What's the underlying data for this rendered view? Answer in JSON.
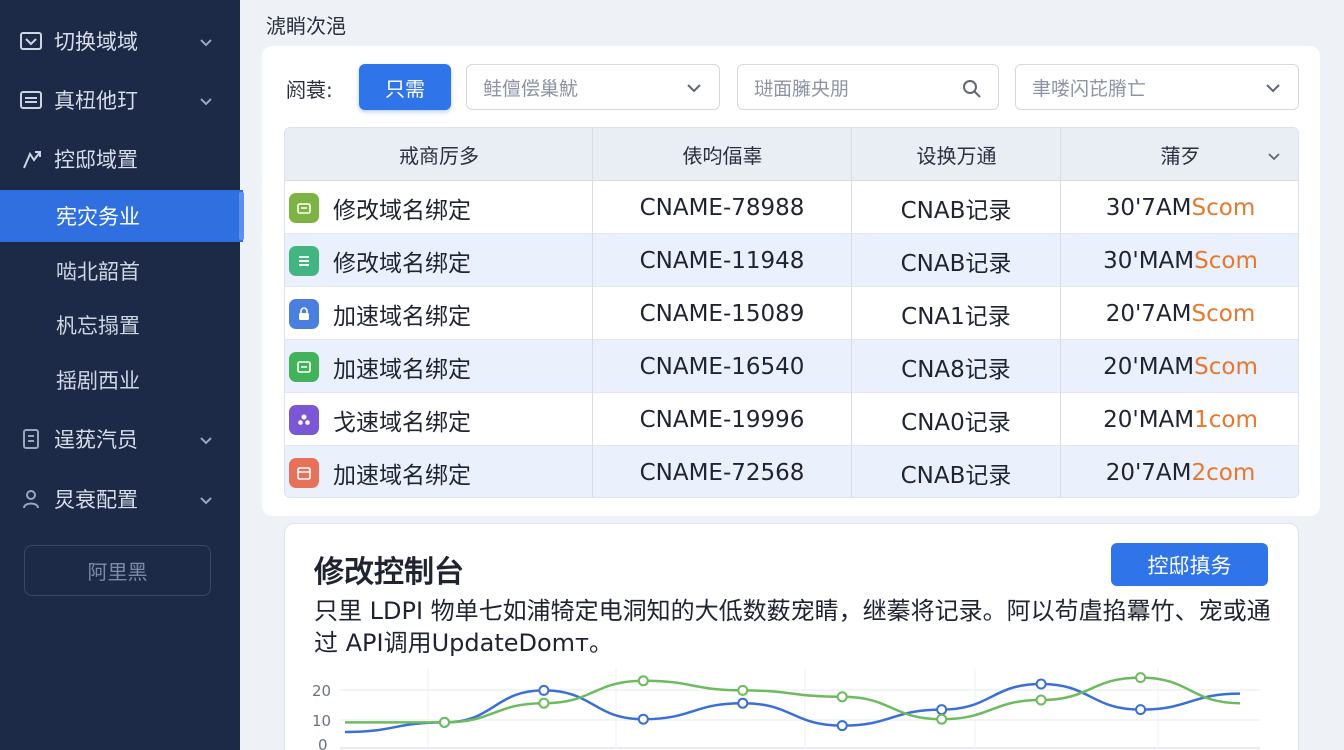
{
  "sidebar": {
    "items": [
      {
        "label": "切换域域",
        "icon": "browser-icon"
      },
      {
        "label": "真杻他玎",
        "icon": "list-icon"
      },
      {
        "label": "控邸域置",
        "icon": "pointer-icon"
      }
    ],
    "sub_items": [
      {
        "label": "宪灾务业"
      },
      {
        "label": "啮北韶首"
      },
      {
        "label": "杋忘搨置"
      },
      {
        "label": "揺剧西业"
      }
    ],
    "items_bottom": [
      {
        "label": "逞莸汽员",
        "icon": "document-icon"
      },
      {
        "label": "炅衰配置",
        "icon": "user-group-icon"
      }
    ],
    "footer_button": "阿里黑"
  },
  "main": {
    "title": "淲睄次浥",
    "filter": {
      "label": "阏蓑:",
      "primary_button": "只需",
      "select_1": "鲑儃偿巢魷",
      "search_placeholder": "琎面臃央朋",
      "select_2": "聿喽闪芘膌亡"
    },
    "table": {
      "headers": [
        "戒商厉多",
        "俵呁偪辜",
        "设换万通",
        "蒲歹"
      ],
      "rows": [
        {
          "name": "修改域名绑定",
          "cname": "CNAME-78988",
          "type": "CNAB记录",
          "time": "30'7AM",
          "suffix": "Scom",
          "icon_color": "#7cb342",
          "icon": "tag-icon"
        },
        {
          "name": "修改域名绑定",
          "cname": "CNAME-11948",
          "type": "CNAB记录",
          "time": "30'MAM",
          "suffix": "Scom",
          "icon_color": "#43b581",
          "icon": "list-icon"
        },
        {
          "name": "加速域名绑定",
          "cname": "CNAME-15089",
          "type": "CNA1记录",
          "time": "20'7AM",
          "suffix": "Scom",
          "icon_color": "#4a7fe0",
          "icon": "lock-icon"
        },
        {
          "name": "加速域名绑定",
          "cname": "CNAME-16540",
          "type": "CNA8记录",
          "time": "20'MAM",
          "suffix": "Scom",
          "icon_color": "#43b35a",
          "icon": "window-icon"
        },
        {
          "name": "戈速域名绑定",
          "cname": "CNAME-19996",
          "type": "CNA0记录",
          "time": "20'MAM",
          "suffix": "1com",
          "icon_color": "#7b57d6",
          "icon": "users-icon"
        },
        {
          "name": "加速域名绑定",
          "cname": "CNAME-72568",
          "type": "CNAB记录",
          "time": "20'7AM",
          "suffix": "2com",
          "icon_color": "#e8715a",
          "icon": "calendar-icon"
        }
      ]
    },
    "console": {
      "title": "修改控制台",
      "button": "控邸搷务",
      "description": "只里 LDPI 物单七如浦犄定电洞知的大低数薮宠睛，继蓁将记录。阿以茍虘掐羃竹、宠或通过 API调用UpdateDom​т。",
      "chart_data": {
        "type": "line",
        "y_ticks": [
          "20",
          "10",
          "0"
        ],
        "series": [
          {
            "color": "#3a6fd8",
            "values": [
              5,
              8,
              18,
              9,
              14,
              7,
              12,
              20,
              12,
              17
            ]
          },
          {
            "color": "#6dbb5f",
            "values": [
              8,
              8,
              14,
              21,
              18,
              16,
              9,
              15,
              22,
              14
            ]
          }
        ]
      }
    }
  }
}
